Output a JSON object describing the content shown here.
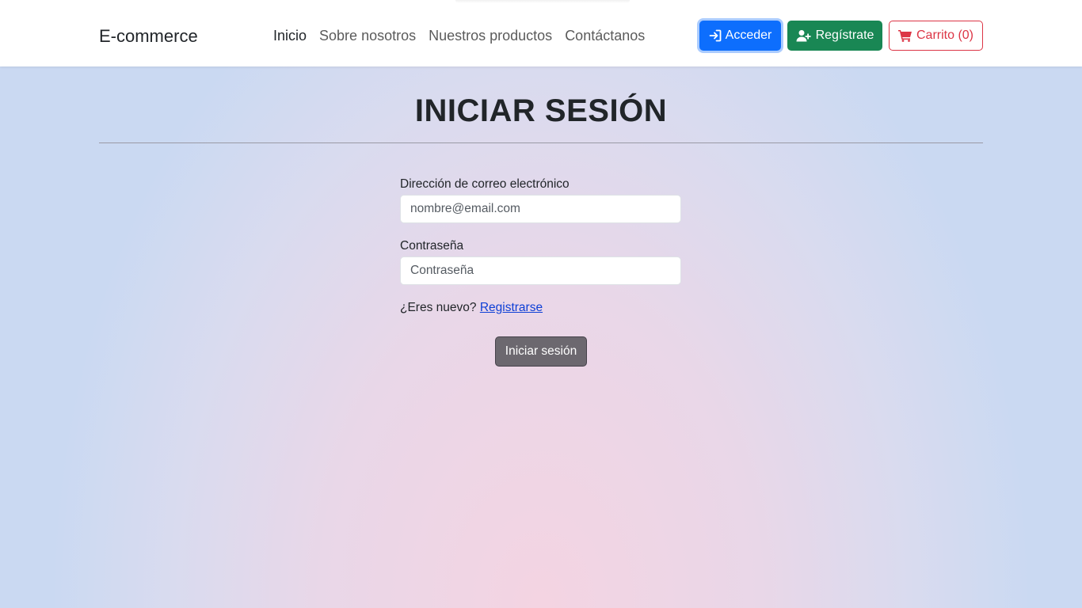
{
  "navbar": {
    "brand": "E-commerce",
    "links": [
      {
        "label": "Inicio",
        "active": true
      },
      {
        "label": "Sobre nosotros",
        "active": false
      },
      {
        "label": "Nuestros productos",
        "active": false
      },
      {
        "label": "Contáctanos",
        "active": false
      }
    ],
    "login_label": "Acceder",
    "register_label": "Regístrate",
    "cart_label": "Carrito (0)",
    "colors": {
      "login": "#0d6efd",
      "register": "#198754",
      "cart": "#dc3545"
    }
  },
  "page": {
    "title": "INICIAR SESIÓN"
  },
  "form": {
    "email_label": "Dirección de correo electrónico",
    "email_placeholder": "nombre@email.com",
    "email_value": "",
    "password_label": "Contraseña",
    "password_placeholder": "Contraseña",
    "password_value": "",
    "new_user_text": "¿Eres nuevo?",
    "register_link": "Registrarse",
    "submit_label": "Iniciar sesión"
  },
  "icons": {
    "login": "sign-in-icon",
    "register": "user-plus-icon",
    "cart": "shopping-cart-icon"
  }
}
